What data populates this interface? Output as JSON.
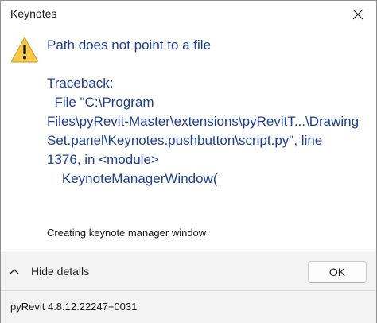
{
  "window": {
    "title": "Keynotes"
  },
  "icons": {
    "close": "close-icon",
    "warning": "warning-icon",
    "chevron": "chevron-up-icon"
  },
  "colors": {
    "instruction_text": "#1c3f95",
    "warning_fill": "#f7c948",
    "button_area_bg": "#f3f3f3"
  },
  "main": {
    "instruction": "Path does not point to a file",
    "traceback": "Traceback:\n  File \"C:\\Program\nFiles\\pyRevit-Master\\extensions\\pyRevitT...\\Drawing\nSet.panel\\Keynotes.pushbutton\\script.py\", line\n1376, in <module>\n    KeynoteManagerWindow(",
    "secondary": "Creating keynote manager window"
  },
  "buttons": {
    "details_toggle": "Hide details",
    "ok": "OK"
  },
  "footer": {
    "text": "pyRevit 4.8.12.22247+0031"
  }
}
